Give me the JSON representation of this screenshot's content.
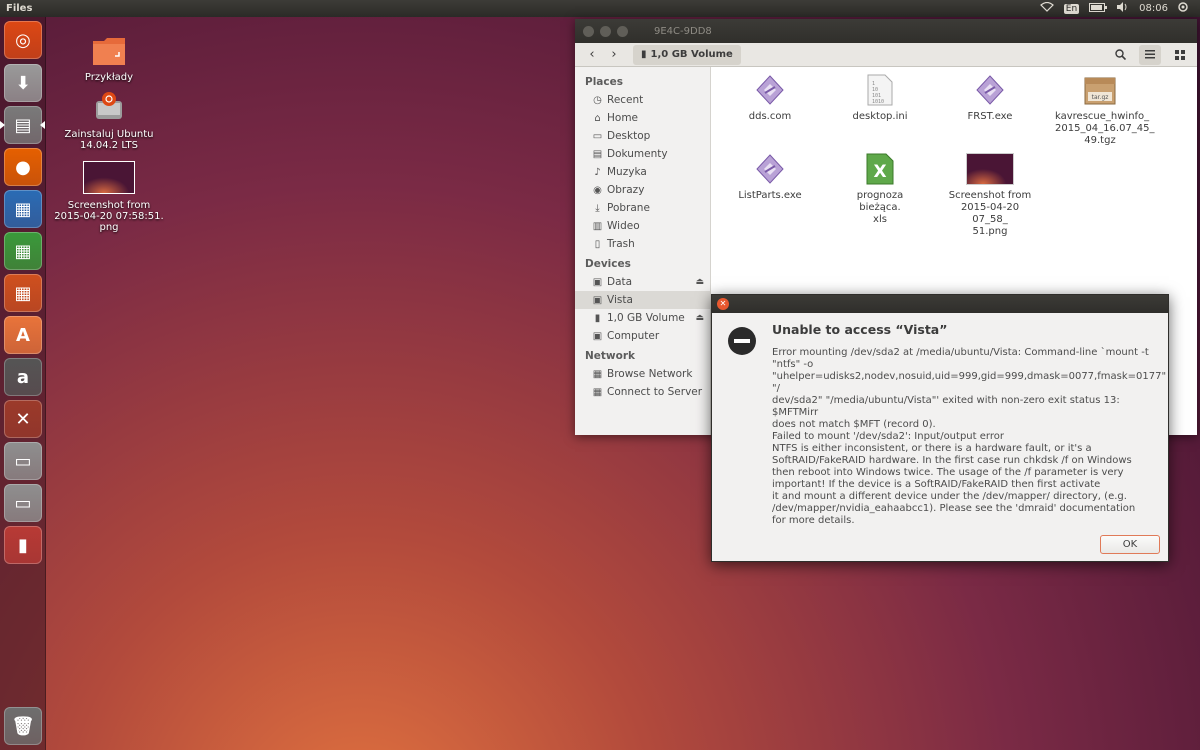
{
  "top_panel": {
    "app_title": "Files",
    "keyboard_layout": "En",
    "clock": "08:06",
    "indicators": [
      "wifi-icon",
      "keyboard-icon",
      "battery-icon",
      "volume-icon",
      "settings-icon"
    ]
  },
  "launcher": {
    "items": [
      {
        "name": "ubuntu-dash",
        "glyph": "◎",
        "color": "#dd4814"
      },
      {
        "name": "install-ubuntu",
        "glyph": "⬇",
        "color": "#9a9a9a"
      },
      {
        "name": "files",
        "glyph": "▤",
        "color": "#7a7a7a"
      },
      {
        "name": "firefox",
        "glyph": "●",
        "color": "#e66000"
      },
      {
        "name": "libreoffice-writer",
        "glyph": "▦",
        "color": "#2a6cb5"
      },
      {
        "name": "libreoffice-calc",
        "glyph": "▦",
        "color": "#3a9a3a"
      },
      {
        "name": "libreoffice-impress",
        "glyph": "▦",
        "color": "#d0501e"
      },
      {
        "name": "ubuntu-software-center",
        "glyph": "A",
        "color": "#e9743a"
      },
      {
        "name": "amazon",
        "glyph": "a",
        "color": "#555555"
      },
      {
        "name": "system-settings",
        "glyph": "✕",
        "color": "#9c3a2a"
      },
      {
        "name": "drive-1",
        "glyph": "▭",
        "color": "#8f8f8f"
      },
      {
        "name": "drive-2",
        "glyph": "▭",
        "color": "#8f8f8f"
      },
      {
        "name": "usb-drive",
        "glyph": "▮",
        "color": "#b83a35"
      },
      {
        "name": "trash",
        "glyph": "🗑",
        "color": "#6e6e6e"
      }
    ]
  },
  "desktop": {
    "icons": [
      {
        "label": "Przykłady",
        "kind": "folder"
      },
      {
        "label": "Zainstaluj Ubuntu\n14.04.2 LTS",
        "kind": "installer"
      },
      {
        "label": "Screenshot from\n2015-04-20 07:58:51.\npng",
        "kind": "image"
      }
    ]
  },
  "file_manager": {
    "window_title": "9E4C-9DD8",
    "path_button": "1,0 GB Volume",
    "sidebar": {
      "places_heading": "Places",
      "places": [
        {
          "label": "Recent",
          "icon": "clock-icon"
        },
        {
          "label": "Home",
          "icon": "home-icon"
        },
        {
          "label": "Desktop",
          "icon": "desktop-icon"
        },
        {
          "label": "Dokumenty",
          "icon": "documents-icon"
        },
        {
          "label": "Muzyka",
          "icon": "music-icon"
        },
        {
          "label": "Obrazy",
          "icon": "camera-icon"
        },
        {
          "label": "Pobrane",
          "icon": "download-icon"
        },
        {
          "label": "Wideo",
          "icon": "video-icon"
        },
        {
          "label": "Trash",
          "icon": "trash-icon"
        }
      ],
      "devices_heading": "Devices",
      "devices": [
        {
          "label": "Data",
          "icon": "drive-icon",
          "eject": true
        },
        {
          "label": "Vista",
          "icon": "drive-icon",
          "eject": false
        },
        {
          "label": "1,0 GB Volume",
          "icon": "usb-icon",
          "eject": true
        },
        {
          "label": "Computer",
          "icon": "drive-icon",
          "eject": false
        }
      ],
      "network_heading": "Network",
      "network": [
        {
          "label": "Browse Network",
          "icon": "network-icon"
        },
        {
          "label": "Connect to Server",
          "icon": "server-icon"
        }
      ]
    },
    "files": [
      {
        "label": "dds.com",
        "kind": "exe"
      },
      {
        "label": "desktop.ini",
        "kind": "text"
      },
      {
        "label": "FRST.exe",
        "kind": "exe"
      },
      {
        "label": "kavrescue_hwinfo_\n2015_04_16.07_45_\n49.tgz",
        "kind": "archive"
      },
      {
        "label": "ListParts.exe",
        "kind": "exe"
      },
      {
        "label": "prognoza bieżąca.\nxls",
        "kind": "spreadsheet"
      },
      {
        "label": "Screenshot from\n2015-04-20 07_58_\n51.png",
        "kind": "image"
      }
    ]
  },
  "dialog": {
    "title": "Unable to access “Vista”",
    "message": "Error mounting /dev/sda2 at /media/ubuntu/Vista: Command-line `mount -t\n\"ntfs\" -o\n\"uhelper=udisks2,nodev,nosuid,uid=999,gid=999,dmask=0077,fmask=0177\" \"/\ndev/sda2\" \"/media/ubuntu/Vista\"' exited with non-zero exit status 13: $MFTMirr\ndoes not match $MFT (record 0).\nFailed to mount '/dev/sda2': Input/output error\nNTFS is either inconsistent, or there is a hardware fault, or it's a\nSoftRAID/FakeRAID hardware. In the first case run chkdsk /f on Windows\nthen reboot into Windows twice. The usage of the /f parameter is very\nimportant! If the device is a SoftRAID/FakeRAID then first activate\nit and mount a different device under the /dev/mapper/ directory, (e.g.\n/dev/mapper/nvidia_eahaabcc1). Please see the 'dmraid' documentation\nfor more details.",
    "ok_label": "OK"
  }
}
